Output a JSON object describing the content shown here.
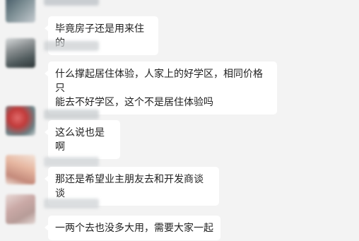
{
  "messages": [
    {
      "text": "毕竟房子还是用来住的"
    },
    {
      "text": "什么撑起居住体验，人家上的好学区，相同价格只\n能去不好学区，这个不是居住体验吗"
    },
    {
      "text": "这么说也是啊"
    },
    {
      "text": "那还是希望业主朋友去和开发商谈谈"
    },
    {
      "text": "一两个去也没多大用，需要大家一起"
    }
  ]
}
